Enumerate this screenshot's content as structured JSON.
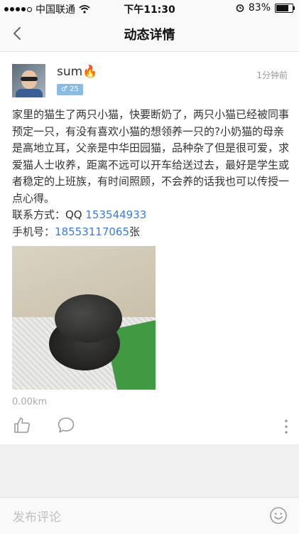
{
  "status_bar": {
    "carrier": "中国联通",
    "time": "下午11:30",
    "battery": "83%",
    "battery_level": 0.83
  },
  "nav": {
    "title": "动态详情",
    "back_icon": "chevron-left-icon"
  },
  "post": {
    "username": "sum🔥",
    "gender_age_badge": "♂ 25",
    "time_ago": "1分钟前",
    "content": "家里的猫生了两只小猫，快要断奶了，两只小猫已经被同事预定一只，有没有喜欢小猫的想领养一只的?小奶猫的母亲是高地立耳，父亲是中华田园猫，品种杂了但是很可爱，求爱猫人士收养，距离不远可以开车给送过去，最好是学生或者稳定的上班族，有时间照顾，不会养的话我也可以传授一点心得。",
    "contact_label": "联系方式：QQ ",
    "contact_qq": "153544933",
    "phone_label": "手机号：",
    "phone_number": "18553117065",
    "phone_suffix": "张",
    "distance": "0.00km"
  },
  "actions": {
    "like_icon": "thumbs-up-icon",
    "comment_icon": "comment-bubble-icon",
    "more_icon": "more-vertical-icon"
  },
  "comment_bar": {
    "placeholder": "发布评论",
    "emoji_icon": "emoji-smile-icon"
  },
  "colors": {
    "link": "#3e7bd6",
    "badge": "#8bbbe0",
    "background": "#f0f0f0"
  }
}
